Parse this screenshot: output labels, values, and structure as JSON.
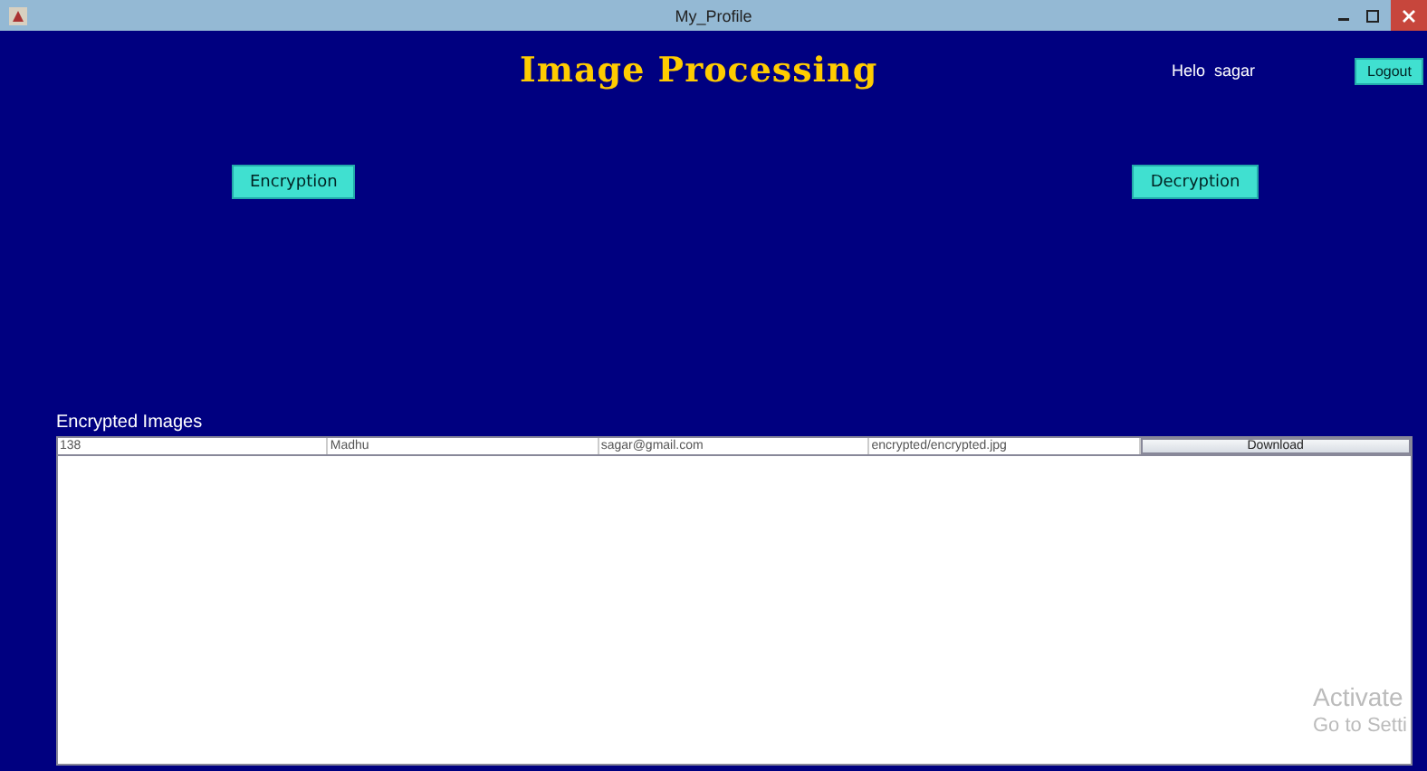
{
  "window": {
    "title": "My_Profile"
  },
  "header": {
    "title": "Image Processing",
    "greeting": "Helo  sagar",
    "logout": "Logout"
  },
  "actions": [
    "Encryption",
    "Decryption"
  ],
  "table": {
    "title": "Encrypted Images",
    "rows": [
      {
        "cells": [
          "138",
          "Madhu",
          "sagar@gmail.com",
          "encrypted/encrypted.jpg"
        ],
        "action": "Download"
      }
    ]
  },
  "overlay": [
    "Activate",
    "Go to Setti"
  ]
}
